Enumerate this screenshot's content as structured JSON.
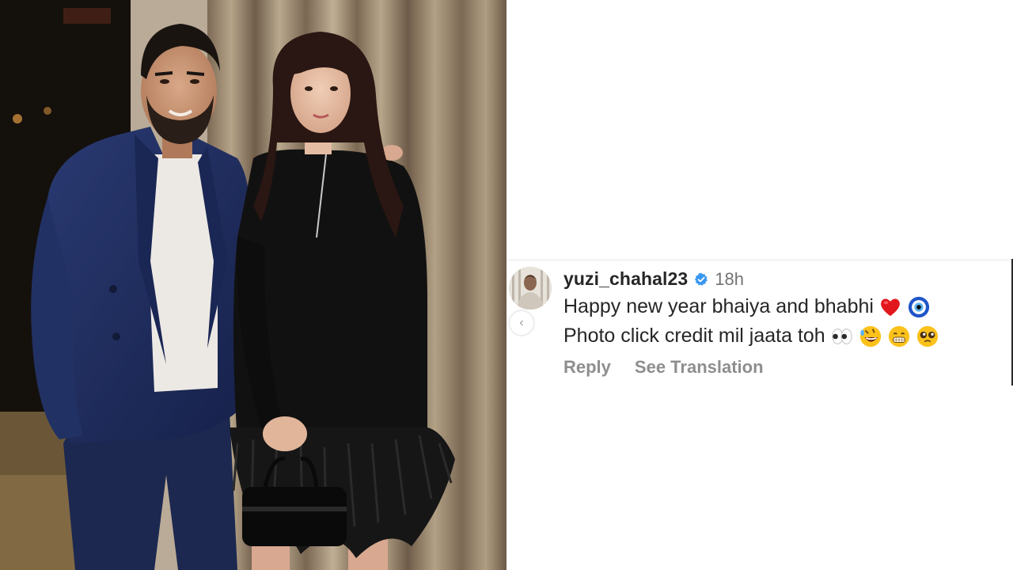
{
  "comment": {
    "username": "yuzi_chahal23",
    "timestamp": "18h",
    "line1": "Happy new year bhaiya and bhabhi",
    "line2": "Photo click credit mil jaata toh",
    "line1_emojis": [
      "red-heart",
      "nazar-amulet"
    ],
    "line2_emojis": [
      "eyes",
      "rolling-on-floor-laughing",
      "beaming-face",
      "pleading-face"
    ],
    "reply_label": "Reply",
    "see_translation_label": "See Translation",
    "verified": true
  },
  "colors": {
    "verified_blue": "#3897f0",
    "username_text": "#262626",
    "meta_text": "#737373",
    "action_text": "#8e8e8e",
    "suit_navy": "#1f2c58",
    "curtain_gold": "#a8947a"
  },
  "icons": {
    "verified": "verified-badge-icon",
    "carousel_prev": "chevron-left-icon"
  }
}
